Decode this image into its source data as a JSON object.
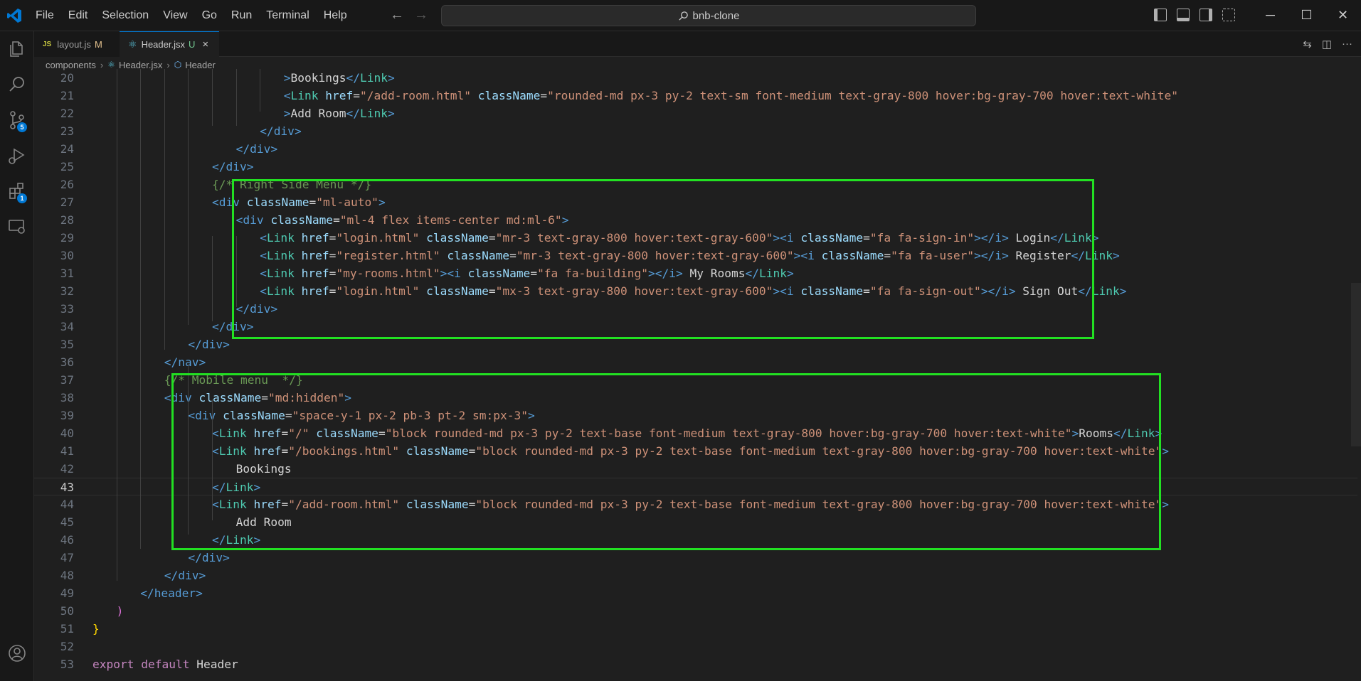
{
  "menu": [
    "File",
    "Edit",
    "Selection",
    "View",
    "Go",
    "Run",
    "Terminal",
    "Help"
  ],
  "search": {
    "label": "bnb-clone"
  },
  "tabs": [
    {
      "icon": "JS",
      "label": "layout.js",
      "status": "M"
    },
    {
      "icon": "react-icon",
      "label": "Header.jsx",
      "status": "U",
      "close": "×"
    }
  ],
  "breadcrumb": {
    "folder": "components",
    "file": "Header.jsx",
    "symbol": "Header"
  },
  "activity_badges": {
    "source_control": "5",
    "extensions": "1"
  },
  "colors": {
    "highlight": "#22e022",
    "accent": "#0078d4"
  },
  "current_line": 43,
  "lines": [
    {
      "n": "20",
      "indent": 0,
      "tokens": [
        [
          "t",
          ">"
        ],
        [
          "p",
          "Bookings"
        ],
        [
          "t",
          "</"
        ],
        [
          "c",
          "Link"
        ],
        [
          "t",
          ">"
        ]
      ]
    },
    {
      "n": "21",
      "indent": 0,
      "tokens": [
        [
          "t",
          "<"
        ],
        [
          "c",
          "Link"
        ],
        [
          "p",
          " "
        ],
        [
          "a",
          "href"
        ],
        [
          "p",
          "="
        ],
        [
          "s",
          "\"/add-room.html\""
        ],
        [
          "p",
          " "
        ],
        [
          "a",
          "className"
        ],
        [
          "p",
          "="
        ],
        [
          "s",
          "\"rounded-md px-3 py-2 text-sm font-medium text-gray-800 hover:bg-gray-700 hover:text-white\""
        ]
      ]
    },
    {
      "n": "22",
      "indent": 0,
      "tokens": [
        [
          "t",
          ">"
        ],
        [
          "p",
          "Add Room"
        ],
        [
          "t",
          "</"
        ],
        [
          "c",
          "Link"
        ],
        [
          "t",
          ">"
        ]
      ]
    },
    {
      "n": "23",
      "indent": 0,
      "tokens": [
        [
          "t",
          "</"
        ],
        [
          "k",
          "div"
        ],
        [
          "t",
          ">"
        ]
      ]
    },
    {
      "n": "24",
      "indent": 0,
      "tokens": [
        [
          "t",
          "</"
        ],
        [
          "k",
          "div"
        ],
        [
          "t",
          ">"
        ]
      ]
    },
    {
      "n": "25",
      "indent": 0,
      "tokens": [
        [
          "t",
          "</"
        ],
        [
          "k",
          "div"
        ],
        [
          "t",
          ">"
        ]
      ]
    },
    {
      "n": "26",
      "indent": 0,
      "tokens": [
        [
          "m",
          "{/* Right Side Menu */}"
        ]
      ]
    },
    {
      "n": "27",
      "indent": 0,
      "tokens": [
        [
          "t",
          "<"
        ],
        [
          "k",
          "div"
        ],
        [
          "p",
          " "
        ],
        [
          "a",
          "className"
        ],
        [
          "p",
          "="
        ],
        [
          "s",
          "\"ml-auto\""
        ],
        [
          "t",
          ">"
        ]
      ]
    },
    {
      "n": "28",
      "indent": 0,
      "tokens": [
        [
          "t",
          "<"
        ],
        [
          "k",
          "div"
        ],
        [
          "p",
          " "
        ],
        [
          "a",
          "className"
        ],
        [
          "p",
          "="
        ],
        [
          "s",
          "\"ml-4 flex items-center md:ml-6\""
        ],
        [
          "t",
          ">"
        ]
      ]
    },
    {
      "n": "29",
      "indent": 0,
      "tokens": [
        [
          "t",
          "<"
        ],
        [
          "c",
          "Link"
        ],
        [
          "p",
          " "
        ],
        [
          "a",
          "href"
        ],
        [
          "p",
          "="
        ],
        [
          "s",
          "\"login.html\""
        ],
        [
          "p",
          " "
        ],
        [
          "a",
          "className"
        ],
        [
          "p",
          "="
        ],
        [
          "s",
          "\"mr-3 text-gray-800 hover:text-gray-600\""
        ],
        [
          "t",
          "><"
        ],
        [
          "k",
          "i"
        ],
        [
          "p",
          " "
        ],
        [
          "a",
          "className"
        ],
        [
          "p",
          "="
        ],
        [
          "s",
          "\"fa fa-sign-in\""
        ],
        [
          "t",
          "></"
        ],
        [
          "k",
          "i"
        ],
        [
          "t",
          ">"
        ],
        [
          "p",
          " Login"
        ],
        [
          "t",
          "</"
        ],
        [
          "c",
          "Link"
        ],
        [
          "t",
          ">"
        ]
      ]
    },
    {
      "n": "30",
      "indent": 0,
      "tokens": [
        [
          "t",
          "<"
        ],
        [
          "c",
          "Link"
        ],
        [
          "p",
          " "
        ],
        [
          "a",
          "href"
        ],
        [
          "p",
          "="
        ],
        [
          "s",
          "\"register.html\""
        ],
        [
          "p",
          " "
        ],
        [
          "a",
          "className"
        ],
        [
          "p",
          "="
        ],
        [
          "s",
          "\"mr-3 text-gray-800 hover:text-gray-600\""
        ],
        [
          "t",
          "><"
        ],
        [
          "k",
          "i"
        ],
        [
          "p",
          " "
        ],
        [
          "a",
          "className"
        ],
        [
          "p",
          "="
        ],
        [
          "s",
          "\"fa fa-user\""
        ],
        [
          "t",
          "></"
        ],
        [
          "k",
          "i"
        ],
        [
          "t",
          ">"
        ],
        [
          "p",
          " Register"
        ],
        [
          "t",
          "</"
        ],
        [
          "c",
          "Link"
        ],
        [
          "t",
          ">"
        ]
      ]
    },
    {
      "n": "31",
      "indent": 0,
      "tokens": [
        [
          "t",
          "<"
        ],
        [
          "c",
          "Link"
        ],
        [
          "p",
          " "
        ],
        [
          "a",
          "href"
        ],
        [
          "p",
          "="
        ],
        [
          "s",
          "\"my-rooms.html\""
        ],
        [
          "t",
          "><"
        ],
        [
          "k",
          "i"
        ],
        [
          "p",
          " "
        ],
        [
          "a",
          "className"
        ],
        [
          "p",
          "="
        ],
        [
          "s",
          "\"fa fa-building\""
        ],
        [
          "t",
          "></"
        ],
        [
          "k",
          "i"
        ],
        [
          "t",
          ">"
        ],
        [
          "p",
          " My Rooms"
        ],
        [
          "t",
          "</"
        ],
        [
          "c",
          "Link"
        ],
        [
          "t",
          ">"
        ]
      ]
    },
    {
      "n": "32",
      "indent": 0,
      "tokens": [
        [
          "t",
          "<"
        ],
        [
          "c",
          "Link"
        ],
        [
          "p",
          " "
        ],
        [
          "a",
          "href"
        ],
        [
          "p",
          "="
        ],
        [
          "s",
          "\"login.html\""
        ],
        [
          "p",
          " "
        ],
        [
          "a",
          "className"
        ],
        [
          "p",
          "="
        ],
        [
          "s",
          "\"mx-3 text-gray-800 hover:text-gray-600\""
        ],
        [
          "t",
          "><"
        ],
        [
          "k",
          "i"
        ],
        [
          "p",
          " "
        ],
        [
          "a",
          "className"
        ],
        [
          "p",
          "="
        ],
        [
          "s",
          "\"fa fa-sign-out\""
        ],
        [
          "t",
          "></"
        ],
        [
          "k",
          "i"
        ],
        [
          "t",
          ">"
        ],
        [
          "p",
          " Sign Out"
        ],
        [
          "t",
          "</"
        ],
        [
          "c",
          "Link"
        ],
        [
          "t",
          ">"
        ]
      ]
    },
    {
      "n": "33",
      "indent": 0,
      "tokens": [
        [
          "t",
          "</"
        ],
        [
          "k",
          "div"
        ],
        [
          "t",
          ">"
        ]
      ]
    },
    {
      "n": "34",
      "indent": 0,
      "tokens": [
        [
          "t",
          "</"
        ],
        [
          "k",
          "div"
        ],
        [
          "t",
          ">"
        ]
      ]
    },
    {
      "n": "35",
      "indent": 0,
      "tokens": [
        [
          "t",
          "</"
        ],
        [
          "k",
          "div"
        ],
        [
          "t",
          ">"
        ]
      ]
    },
    {
      "n": "36",
      "indent": 0,
      "tokens": [
        [
          "t",
          "</"
        ],
        [
          "k",
          "nav"
        ],
        [
          "t",
          ">"
        ]
      ]
    },
    {
      "n": "37",
      "indent": 0,
      "tokens": [
        [
          "m",
          "{/* Mobile menu  */}"
        ]
      ]
    },
    {
      "n": "38",
      "indent": 0,
      "tokens": [
        [
          "t",
          "<"
        ],
        [
          "k",
          "div"
        ],
        [
          "p",
          " "
        ],
        [
          "a",
          "className"
        ],
        [
          "p",
          "="
        ],
        [
          "s",
          "\"md:hidden\""
        ],
        [
          "t",
          ">"
        ]
      ]
    },
    {
      "n": "39",
      "indent": 0,
      "tokens": [
        [
          "t",
          "<"
        ],
        [
          "k",
          "div"
        ],
        [
          "p",
          " "
        ],
        [
          "a",
          "className"
        ],
        [
          "p",
          "="
        ],
        [
          "s",
          "\"space-y-1 px-2 pb-3 pt-2 sm:px-3\""
        ],
        [
          "t",
          ">"
        ]
      ]
    },
    {
      "n": "40",
      "indent": 0,
      "tokens": [
        [
          "t",
          "<"
        ],
        [
          "c",
          "Link"
        ],
        [
          "p",
          " "
        ],
        [
          "a",
          "href"
        ],
        [
          "p",
          "="
        ],
        [
          "s",
          "\"/\""
        ],
        [
          "p",
          " "
        ],
        [
          "a",
          "className"
        ],
        [
          "p",
          "="
        ],
        [
          "s",
          "\"block rounded-md px-3 py-2 text-base font-medium text-gray-800 hover:bg-gray-700 hover:text-white\""
        ],
        [
          "t",
          ">"
        ],
        [
          "p",
          "Rooms"
        ],
        [
          "t",
          "</"
        ],
        [
          "c",
          "Link"
        ],
        [
          "t",
          ">"
        ]
      ]
    },
    {
      "n": "41",
      "indent": 0,
      "tokens": [
        [
          "t",
          "<"
        ],
        [
          "c",
          "Link"
        ],
        [
          "p",
          " "
        ],
        [
          "a",
          "href"
        ],
        [
          "p",
          "="
        ],
        [
          "s",
          "\"/bookings.html\""
        ],
        [
          "p",
          " "
        ],
        [
          "a",
          "className"
        ],
        [
          "p",
          "="
        ],
        [
          "s",
          "\"block rounded-md px-3 py-2 text-base font-medium text-gray-800 hover:bg-gray-700 hover:text-white\""
        ],
        [
          "t",
          ">"
        ]
      ]
    },
    {
      "n": "42",
      "indent": 0,
      "tokens": [
        [
          "p",
          "Bookings"
        ]
      ]
    },
    {
      "n": "43",
      "indent": 0,
      "tokens": [
        [
          "t",
          "</"
        ],
        [
          "c",
          "Link"
        ],
        [
          "t",
          ">"
        ]
      ]
    },
    {
      "n": "44",
      "indent": 0,
      "tokens": [
        [
          "t",
          "<"
        ],
        [
          "c",
          "Link"
        ],
        [
          "p",
          " "
        ],
        [
          "a",
          "href"
        ],
        [
          "p",
          "="
        ],
        [
          "s",
          "\"/add-room.html\""
        ],
        [
          "p",
          " "
        ],
        [
          "a",
          "className"
        ],
        [
          "p",
          "="
        ],
        [
          "s",
          "\"block rounded-md px-3 py-2 text-base font-medium text-gray-800 hover:bg-gray-700 hover:text-white\""
        ],
        [
          "t",
          ">"
        ]
      ]
    },
    {
      "n": "45",
      "indent": 0,
      "tokens": [
        [
          "p",
          "Add Room"
        ]
      ]
    },
    {
      "n": "46",
      "indent": 0,
      "tokens": [
        [
          "t",
          "</"
        ],
        [
          "c",
          "Link"
        ],
        [
          "t",
          ">"
        ]
      ]
    },
    {
      "n": "47",
      "indent": 0,
      "tokens": [
        [
          "t",
          "</"
        ],
        [
          "k",
          "div"
        ],
        [
          "t",
          ">"
        ]
      ]
    },
    {
      "n": "48",
      "indent": 0,
      "tokens": [
        [
          "t",
          "</"
        ],
        [
          "k",
          "div"
        ],
        [
          "t",
          ">"
        ]
      ]
    },
    {
      "n": "49",
      "indent": 0,
      "tokens": [
        [
          "t",
          "</"
        ],
        [
          "k",
          "header"
        ],
        [
          "t",
          ">"
        ]
      ]
    },
    {
      "n": "50",
      "indent": 0,
      "tokens": [
        [
          "b1",
          ")"
        ]
      ]
    },
    {
      "n": "51",
      "indent": 0,
      "tokens": [
        [
          "b2",
          "}"
        ]
      ]
    },
    {
      "n": "52",
      "indent": 0,
      "tokens": []
    },
    {
      "n": "53",
      "indent": 0,
      "tokens": [
        [
          "kw",
          "export"
        ],
        [
          "p",
          " "
        ],
        [
          "kw",
          "default"
        ],
        [
          "p",
          " Header"
        ]
      ]
    }
  ]
}
